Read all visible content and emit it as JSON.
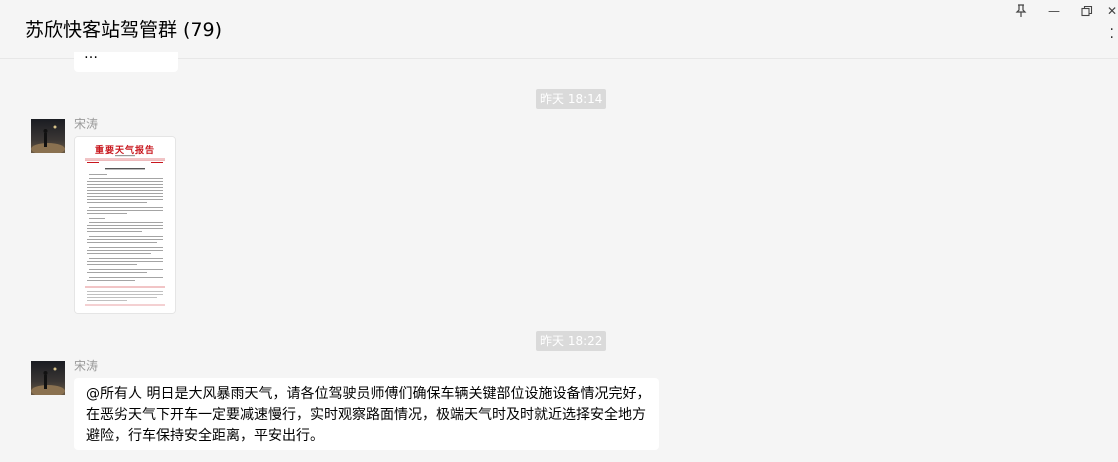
{
  "window": {
    "title": "苏欣快客站驾管群 (79)",
    "controls": {
      "pin_icon": "pin-icon",
      "minimize_glyph": "—",
      "restore_icon": "restore-icon",
      "close_glyph": "✕"
    }
  },
  "messages": {
    "previous_partial_text": "…",
    "timestamp_1": "昨天 18:14",
    "message_1": {
      "sender": "宋涛",
      "document_title": "重要天气报告"
    },
    "timestamp_2": "昨天 18:22",
    "message_2": {
      "sender": "宋涛",
      "text": "@所有人 明日是大风暴雨天气，请各位驾驶员师傅们确保车辆关键部位设施设备情况完好，在恶劣天气下开车一定要减速慢行，实时观察路面情况，极端天气时及时就近选择安全地方避险，行车保持安全距离，平安出行。"
    }
  },
  "colors": {
    "background": "#f5f5f5",
    "bubble": "#ffffff",
    "timestamp_bg": "#dadada",
    "document_title_red": "#c8161d"
  }
}
